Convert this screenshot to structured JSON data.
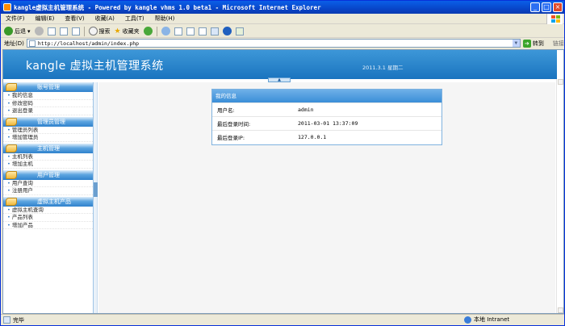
{
  "window": {
    "title": "kangle虚拟主机管理系统 - Powered by kangle vhms 1.0 beta1 - Microsoft Internet Explorer"
  },
  "menu": [
    "文件(F)",
    "编辑(E)",
    "查看(V)",
    "收藏(A)",
    "工具(T)",
    "帮助(H)"
  ],
  "toolbar": {
    "back": "后退",
    "search": "搜索",
    "favorites": "收藏夹"
  },
  "address": {
    "label": "地址(D)",
    "url": "http://localhost/admin/index.php",
    "go": "转到",
    "links": "链接"
  },
  "banner": {
    "title": "kangle 虚拟主机管理系统",
    "date": "2011.3.1 星期二"
  },
  "sidebar": {
    "sections": [
      {
        "title": "账号管理",
        "items": [
          "我的信息",
          "修改密码",
          "退出登录"
        ]
      },
      {
        "title": "管理员管理",
        "items": [
          "管理员列表",
          "增加管理员"
        ]
      },
      {
        "title": "主机管理",
        "items": [
          "主机列表",
          "增加主机"
        ]
      },
      {
        "title": "用户管理",
        "items": [
          "用户查询",
          "注册用户"
        ]
      },
      {
        "title": "虚拟主机产品",
        "items": [
          "虚拟主机查询",
          "产品列表",
          "增加产品"
        ]
      }
    ]
  },
  "info_panel": {
    "heading": "我的信息",
    "rows": [
      {
        "label": "用户名:",
        "value": "admin"
      },
      {
        "label": "最后登录时间:",
        "value": "2011-03-01 13:37:09"
      },
      {
        "label": "最后登录IP:",
        "value": "127.0.0.1"
      }
    ]
  },
  "status": {
    "text": "完毕",
    "zone": "本地 Intranet"
  },
  "colors": {
    "titlebar": "#0a5fe8",
    "banner": "#2a84cc",
    "panel_header": "#4a9ade"
  }
}
